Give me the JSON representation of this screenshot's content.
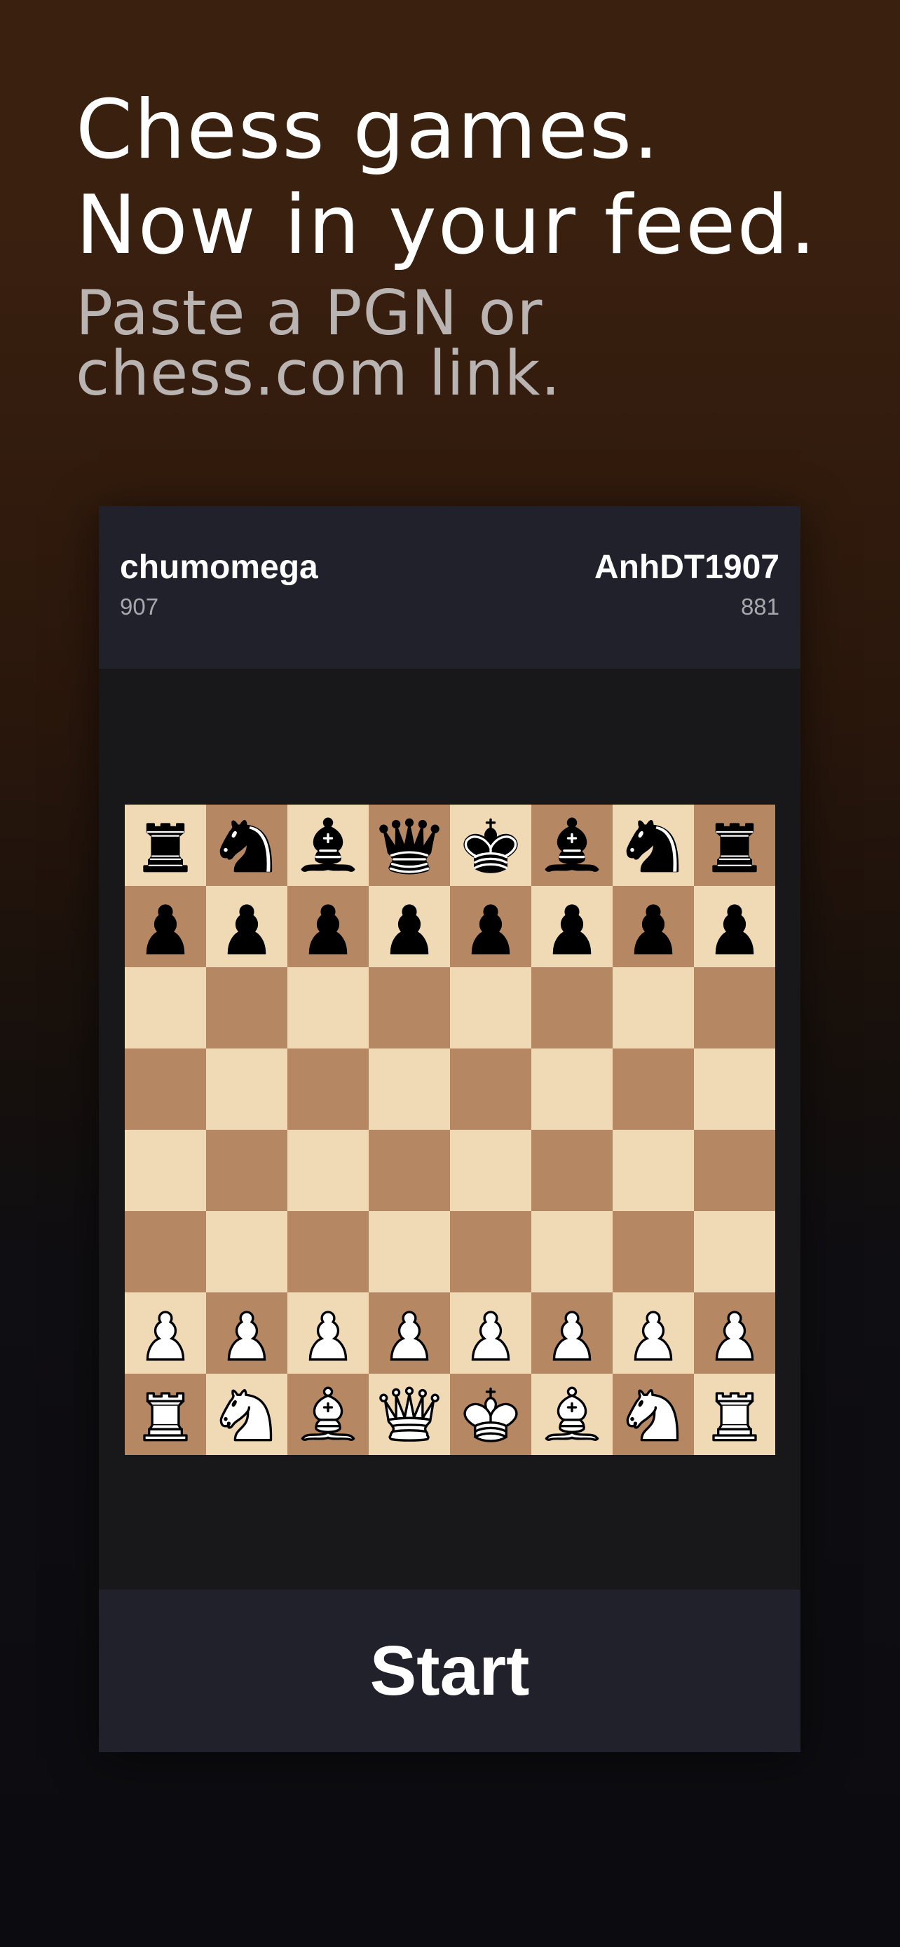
{
  "hero": {
    "headline_line1": "Chess games.",
    "headline_line2": "Now in your feed.",
    "subhead_line1": "Paste a PGN or",
    "subhead_line2": "chess.com link."
  },
  "game": {
    "white_player": {
      "name": "chumomega",
      "rating": "907"
    },
    "black_player": {
      "name": "AnhDT1907",
      "rating": "881"
    }
  },
  "board": {
    "light_color": "#f0d9b5",
    "dark_color": "#b58863",
    "ranks": [
      [
        "bR",
        "bN",
        "bB",
        "bQ",
        "bK",
        "bB",
        "bN",
        "bR"
      ],
      [
        "bP",
        "bP",
        "bP",
        "bP",
        "bP",
        "bP",
        "bP",
        "bP"
      ],
      [
        "",
        "",
        "",
        "",
        "",
        "",
        "",
        ""
      ],
      [
        "",
        "",
        "",
        "",
        "",
        "",
        "",
        ""
      ],
      [
        "",
        "",
        "",
        "",
        "",
        "",
        "",
        ""
      ],
      [
        "",
        "",
        "",
        "",
        "",
        "",
        "",
        ""
      ],
      [
        "wP",
        "wP",
        "wP",
        "wP",
        "wP",
        "wP",
        "wP",
        "wP"
      ],
      [
        "wR",
        "wN",
        "wB",
        "wQ",
        "wK",
        "wB",
        "wN",
        "wR"
      ]
    ]
  },
  "actions": {
    "start_label": "Start"
  }
}
